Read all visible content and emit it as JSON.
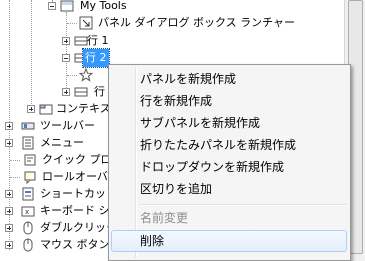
{
  "tree": {
    "items": [
      {
        "label": "My Tools"
      },
      {
        "label": "パネル ダイアログ ボックス ランチャー"
      },
      {
        "label": "行 1"
      },
      {
        "label": "行 2"
      },
      {
        "label": "行"
      },
      {
        "label": "コンテキス"
      },
      {
        "label": "ツールバー"
      },
      {
        "label": "メニュー"
      },
      {
        "label": "クイック プロパ"
      },
      {
        "label": "ロールオーバ"
      },
      {
        "label": "ショートカット"
      },
      {
        "label": "キーボード シ"
      },
      {
        "label": "ダブルクリック"
      },
      {
        "label": "マウス ボタン"
      }
    ]
  },
  "context_menu": {
    "items": [
      {
        "label": "パネルを新規作成"
      },
      {
        "label": "行を新規作成"
      },
      {
        "label": "サブパネルを新規作成"
      },
      {
        "label": "折りたたみパネルを新規作成"
      },
      {
        "label": "ドロップダウンを新規作成"
      },
      {
        "label": "区切りを追加"
      },
      {
        "label": "名前変更"
      },
      {
        "label": "削除"
      }
    ]
  },
  "colors": {
    "selection": "#3399ff",
    "menu_bg": "#f5f5f5",
    "hover_border": "#aecff7"
  }
}
